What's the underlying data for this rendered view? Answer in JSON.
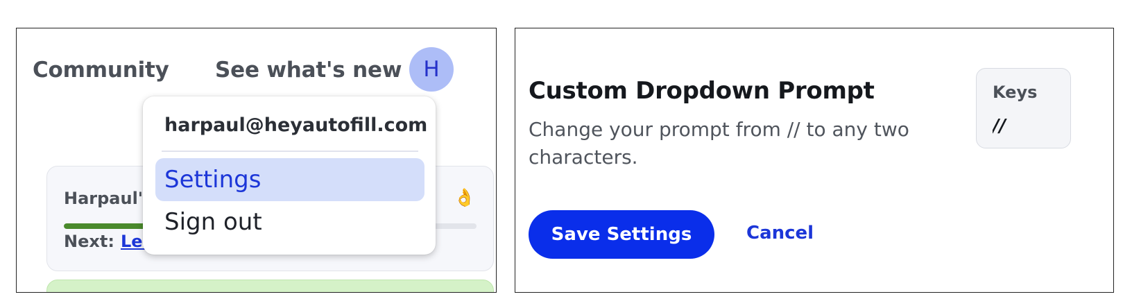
{
  "left_panel": {
    "nav": {
      "community_label": "Community",
      "whats_new_label": "See what's new"
    },
    "avatar": {
      "initial": "H",
      "bg_color": "#adbdf7"
    },
    "progress_card": {
      "title_visible": "Harpaul's",
      "emoji": "👌",
      "next_label": "Next:",
      "next_link_visible": "Lea",
      "progress_fraction": 0.22
    },
    "user_menu": {
      "email": "harpaul@heyautofill.com",
      "items": [
        {
          "label": "Settings",
          "selected": true
        },
        {
          "label": "Sign out",
          "selected": false
        }
      ]
    }
  },
  "right_panel": {
    "title": "Custom Dropdown Prompt",
    "description": "Change your prompt from // to any two characters.",
    "keys": {
      "label": "Keys",
      "value": "//"
    },
    "actions": {
      "save_label": "Save Settings",
      "cancel_label": "Cancel"
    },
    "colors": {
      "accent": "#0a2eea",
      "link": "#1c36d8"
    }
  }
}
